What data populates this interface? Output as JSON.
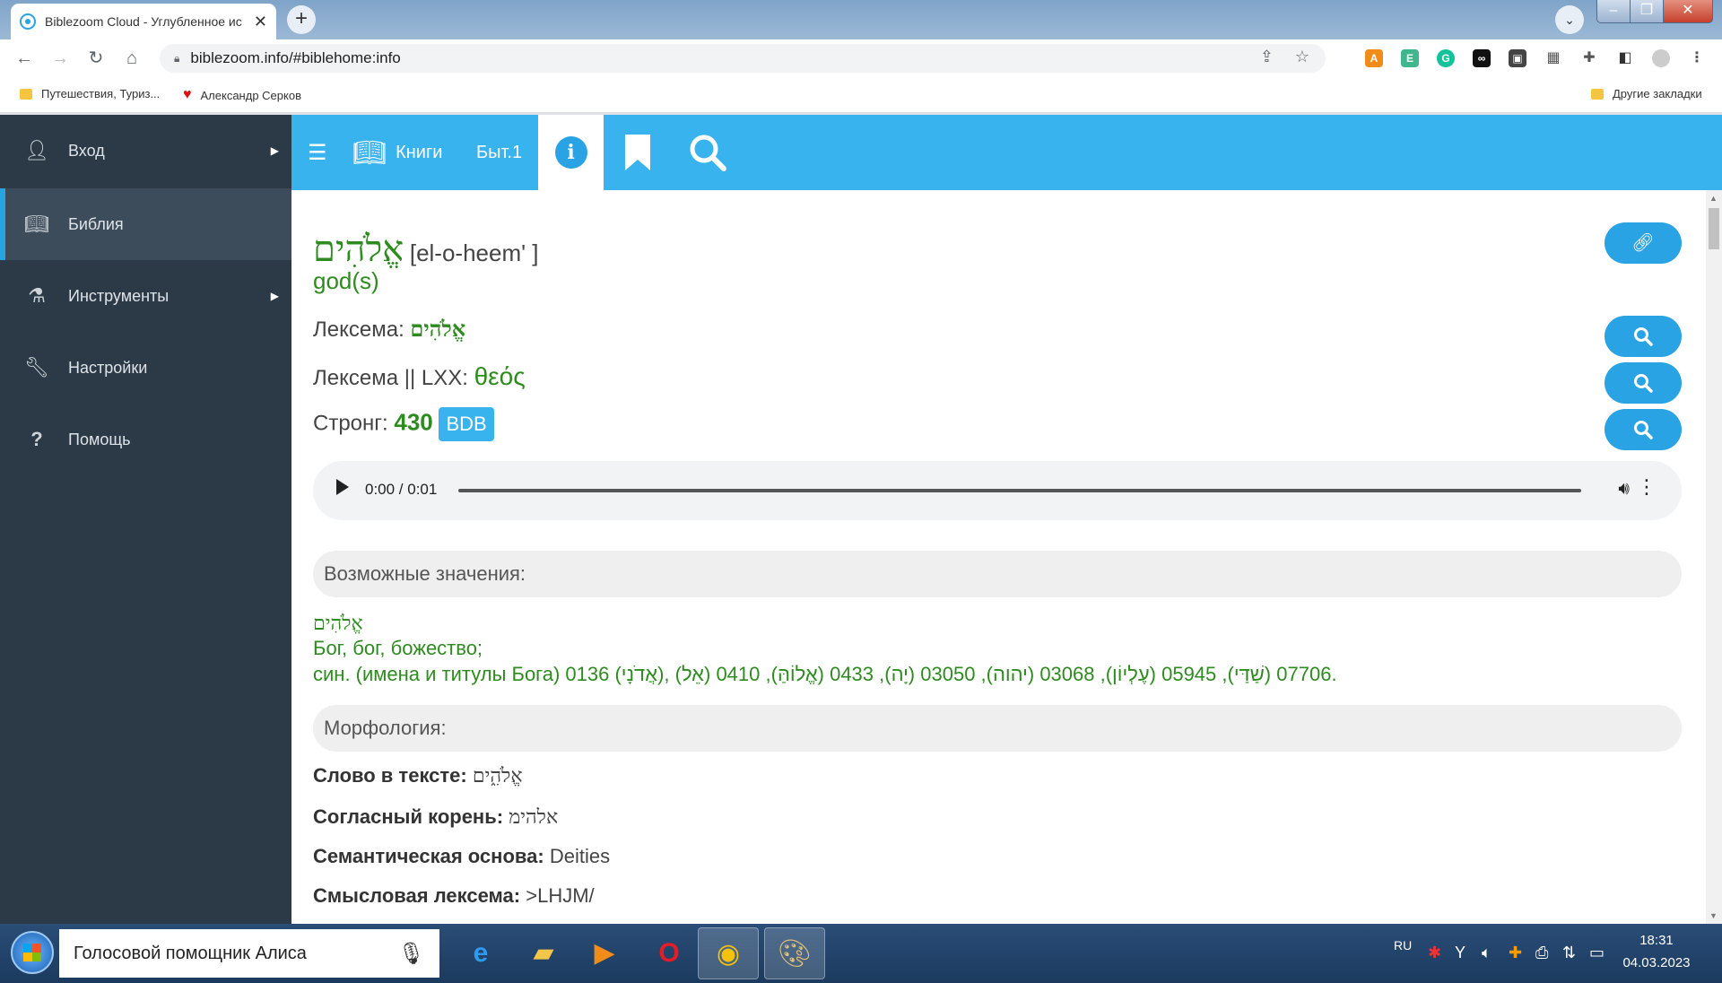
{
  "browser": {
    "tab_title": "Biblezoom Cloud - Углубленное ис",
    "url": "biblezoom.info/#biblehome:info",
    "bookmarks": [
      "Путешествия, Туриз...",
      "Александр Серков"
    ],
    "other_bookmarks": "Другие закладки"
  },
  "sidebar": {
    "items": [
      {
        "label": "Вход",
        "icon": "user-icon"
      },
      {
        "label": "Библия",
        "icon": "book-icon"
      },
      {
        "label": "Инструменты",
        "icon": "flask-icon"
      },
      {
        "label": "Настройки",
        "icon": "wrench-icon"
      },
      {
        "label": "Помощь",
        "icon": "question-icon"
      }
    ]
  },
  "topbar": {
    "books_label": "Книги",
    "chapter_label": "Быт.1"
  },
  "word": {
    "hebrew": "אֱלֹהִים",
    "transliteration": "[el-o-heem' ]",
    "gloss": "god(s)",
    "lexeme_label": "Лексема:",
    "lexeme_value": "אֱלֹהִים",
    "lxx_label": "Лексема || LXX:",
    "lxx_value": "θεός",
    "strong_label": "Стронг:",
    "strong_value": "430",
    "bdb_label": "BDB"
  },
  "audio": {
    "time": "0:00 / 0:01",
    "progress_fraction": 0
  },
  "meanings": {
    "title": "Возможные значения:",
    "line1": "אֱלֹהִים",
    "line2": "Бог, бог, божество;",
    "line3": "син. (имена и титулы Бога) 0136 (אֲדֹנָי), 07706 (שַׁדַּי), 05945 (עֶלְיוֹן), 03068 (יהוה), 03050 (יָה), 0433 (אֱלוֹהַּ), 0410 (אֵל)."
  },
  "morphology": {
    "title": "Морфология:",
    "rows": [
      {
        "label": "Слово в тексте:",
        "value": "אֱלֹהִ֑ים"
      },
      {
        "label": "Согласный корень:",
        "value": "אלהימ"
      },
      {
        "label": "Семантическая основа:",
        "value": "Deities"
      },
      {
        "label": "Смысловая лексема:",
        "value": ">LHJM/"
      }
    ]
  },
  "taskbar": {
    "assistant_label": "Голосовой помощник Алиса",
    "lang": "RU",
    "time": "18:31",
    "date": "04.03.2023"
  },
  "colors": {
    "accent": "#39b3ee",
    "sidebar": "#2c3a47",
    "green_text": "#2e8b1f"
  }
}
